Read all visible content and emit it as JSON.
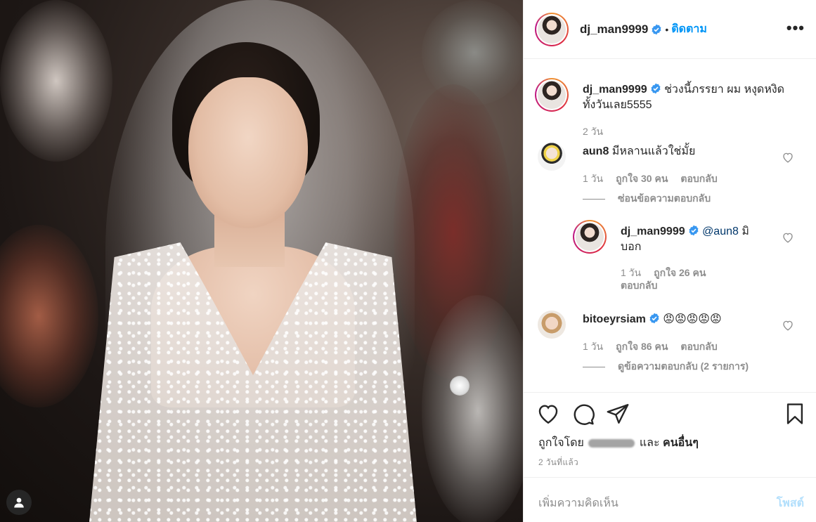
{
  "post": {
    "username": "dj_man9999",
    "follow_label": "ติดตาม",
    "more_label": "•••",
    "caption_text": "ช่วงนี้ภรรยา ผม หงุดหงิด ทั้งวันเลย5555",
    "caption_time": "2 วัน"
  },
  "comments": [
    {
      "username": "aun8",
      "text": "มีหลานแล้วใช่มั้ย",
      "time": "1 วัน",
      "likes": "ถูกใจ 30 คน",
      "reply_label": "ตอบกลับ",
      "toggle_replies": "ซ่อนข้อความตอบกลับ",
      "reply": {
        "username": "dj_man9999",
        "mention": "@aun8",
        "text": "มิ บอก",
        "time": "1 วัน",
        "likes": "ถูกใจ 26 คน",
        "reply_label": "ตอบกลับ"
      }
    },
    {
      "username": "bitoeyrsiam",
      "text": "😡😡😡😡😡",
      "time": "1 วัน",
      "likes": "ถูกใจ 86 คน",
      "reply_label": "ตอบกลับ",
      "toggle_replies": "ดูข้อความตอบกลับ (2 รายการ)"
    }
  ],
  "likes_row": {
    "prefix": "ถูกใจโดย",
    "middle": "และ",
    "suffix": "คนอื่นๆ"
  },
  "timestamp": "2 วันที่แล้ว",
  "add_comment": {
    "placeholder": "เพิ่มความคิดเห็น",
    "post_label": "โพสต์"
  },
  "icons": {
    "verified": "verified-badge-icon",
    "like": "heart-icon",
    "comment": "comment-icon",
    "share": "paper-plane-icon",
    "save": "bookmark-icon",
    "user": "user-icon"
  },
  "colors": {
    "link_blue": "#0095f6",
    "post_disabled": "#b2dffc",
    "secondary_text": "#8e8e8e"
  }
}
